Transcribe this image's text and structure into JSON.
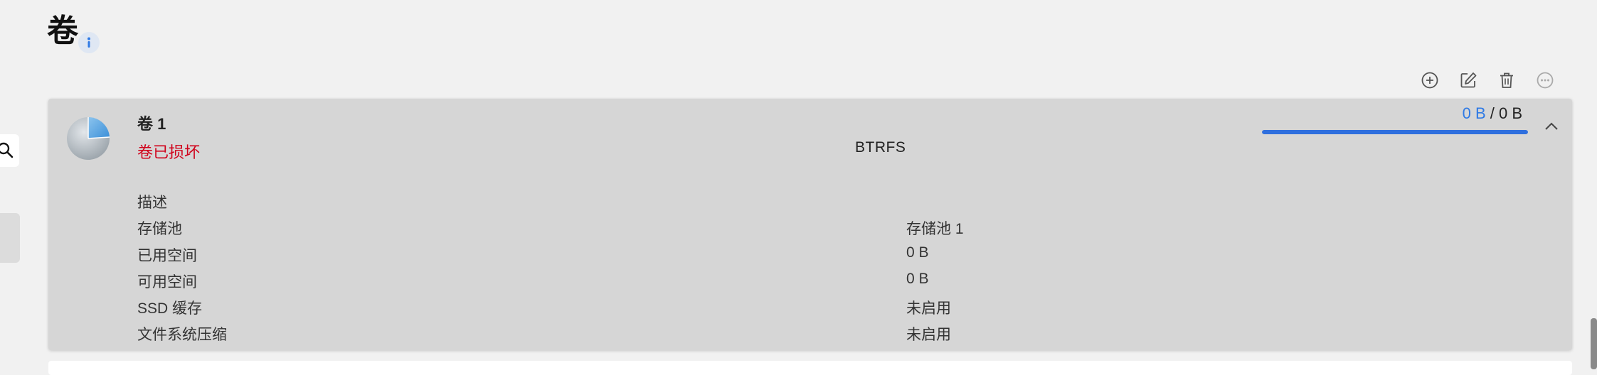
{
  "page": {
    "title": "卷"
  },
  "volume": {
    "name": "卷 1",
    "status": "卷已损坏",
    "filesystem": "BTRFS",
    "usage_used": "0 B",
    "usage_separator": " / ",
    "usage_total": "0 B",
    "usage_fraction": 1.0,
    "details": [
      {
        "label": "描述",
        "value": ""
      },
      {
        "label": "存储池",
        "value": "存储池 1"
      },
      {
        "label": "已用空间",
        "value": "0 B"
      },
      {
        "label": "可用空间",
        "value": "0 B"
      },
      {
        "label": "SSD 缓存",
        "value": "未启用"
      },
      {
        "label": "文件系统压缩",
        "value": "未启用"
      }
    ]
  },
  "icons": {
    "info": "info-icon",
    "toolbar": [
      "add-icon",
      "edit-icon",
      "delete-icon",
      "more-icon"
    ],
    "collapse": "chevron-up-icon",
    "sidebar_search": "search-icon"
  },
  "colors": {
    "status_error": "#d0021b",
    "accent_blue": "#2f7ae5",
    "panel_bg": "#d6d6d6"
  }
}
